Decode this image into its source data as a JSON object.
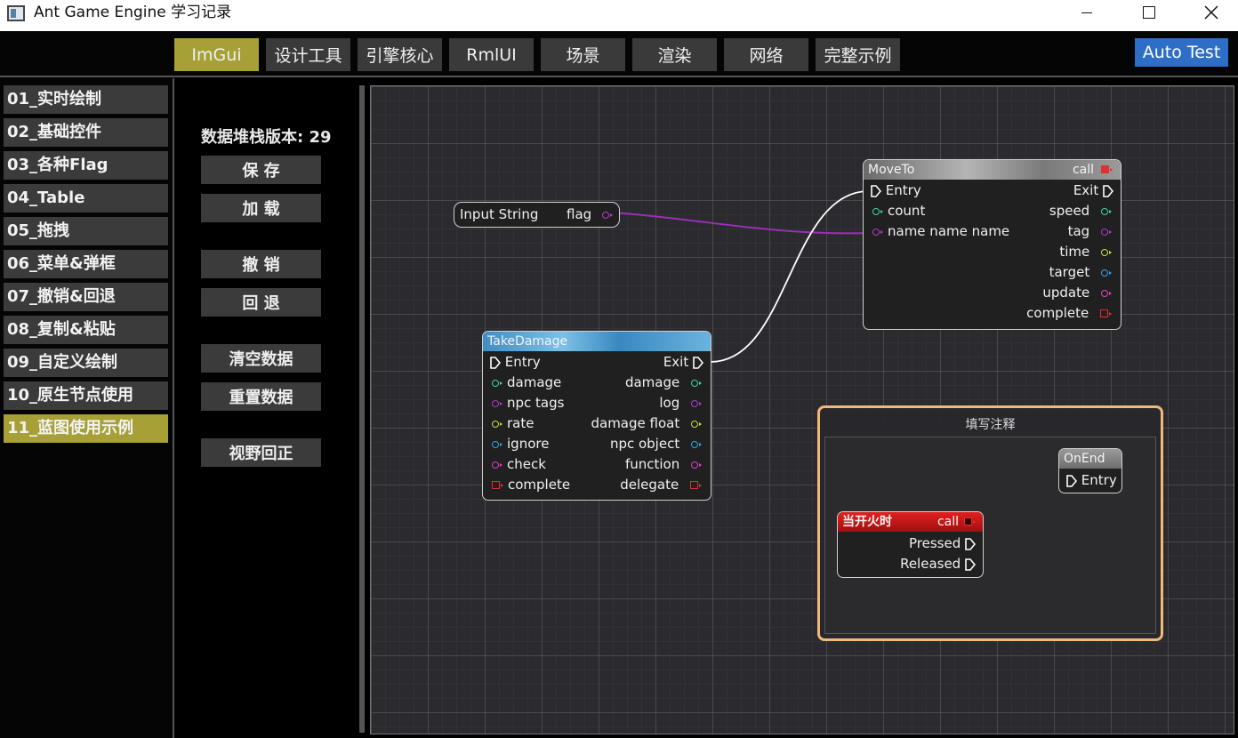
{
  "window": {
    "title": "Ant Game Engine 学习记录"
  },
  "top_tabs": [
    {
      "label": "ImGui",
      "active": true
    },
    {
      "label": "设计工具",
      "active": false
    },
    {
      "label": "引擎核心",
      "active": false
    },
    {
      "label": "RmlUI",
      "active": false
    },
    {
      "label": "场景",
      "active": false
    },
    {
      "label": "渲染",
      "active": false
    },
    {
      "label": "网络",
      "active": false
    },
    {
      "label": "完整示例",
      "active": false
    }
  ],
  "auto_test_label": "Auto Test",
  "sidebar": {
    "items": [
      {
        "label": "01_实时绘制"
      },
      {
        "label": "02_基础控件"
      },
      {
        "label": "03_各种Flag"
      },
      {
        "label": "04_Table"
      },
      {
        "label": "05_拖拽"
      },
      {
        "label": "06_菜单&弹框"
      },
      {
        "label": "07_撤销&回退"
      },
      {
        "label": "08_复制&粘贴"
      },
      {
        "label": "09_自定义绘制"
      },
      {
        "label": "10_原生节点使用"
      },
      {
        "label": "11_蓝图使用示例"
      }
    ],
    "active_index": 10
  },
  "panel": {
    "version_text": "数据堆栈版本: 29",
    "buttons": {
      "save": "保 存",
      "load": "加 载",
      "undo": "撤 销",
      "redo": "回 退",
      "clear": "清空数据",
      "reset": "重置数据",
      "center": "视野回正"
    }
  },
  "colors": {
    "accent": "#a6a036",
    "auto_test": "#2d6fc6",
    "pin_green": "#3fd6a0",
    "pin_purple": "#b03cc8",
    "pin_yellow": "#c8e03a",
    "pin_blue": "#3aa0e0",
    "pin_magenta": "#e040c0",
    "pin_red": "#e03030",
    "comment_border": "#f0b87a"
  },
  "graph": {
    "input_string": {
      "label": "Input String",
      "pin": "flag"
    },
    "moveto": {
      "title": "MoveTo",
      "call": "call",
      "inputs": [
        "Entry",
        "count",
        "name name name"
      ],
      "outputs": [
        "Exit",
        "speed",
        "tag",
        "time",
        "target",
        "update",
        "complete"
      ]
    },
    "takedamage": {
      "title": "TakeDamage",
      "inputs": [
        "Entry",
        "damage",
        "npc tags",
        "rate",
        "ignore",
        "check",
        "complete"
      ],
      "outputs": [
        "Exit",
        "damage",
        "log",
        "damage float",
        "npc object",
        "function",
        "delegate"
      ]
    },
    "comment": {
      "title": "填写注释"
    },
    "onend": {
      "title": "OnEnd",
      "input": "Entry"
    },
    "onfire": {
      "title": "当开火时",
      "call": "call",
      "outputs": [
        "Pressed",
        "Released"
      ]
    }
  }
}
